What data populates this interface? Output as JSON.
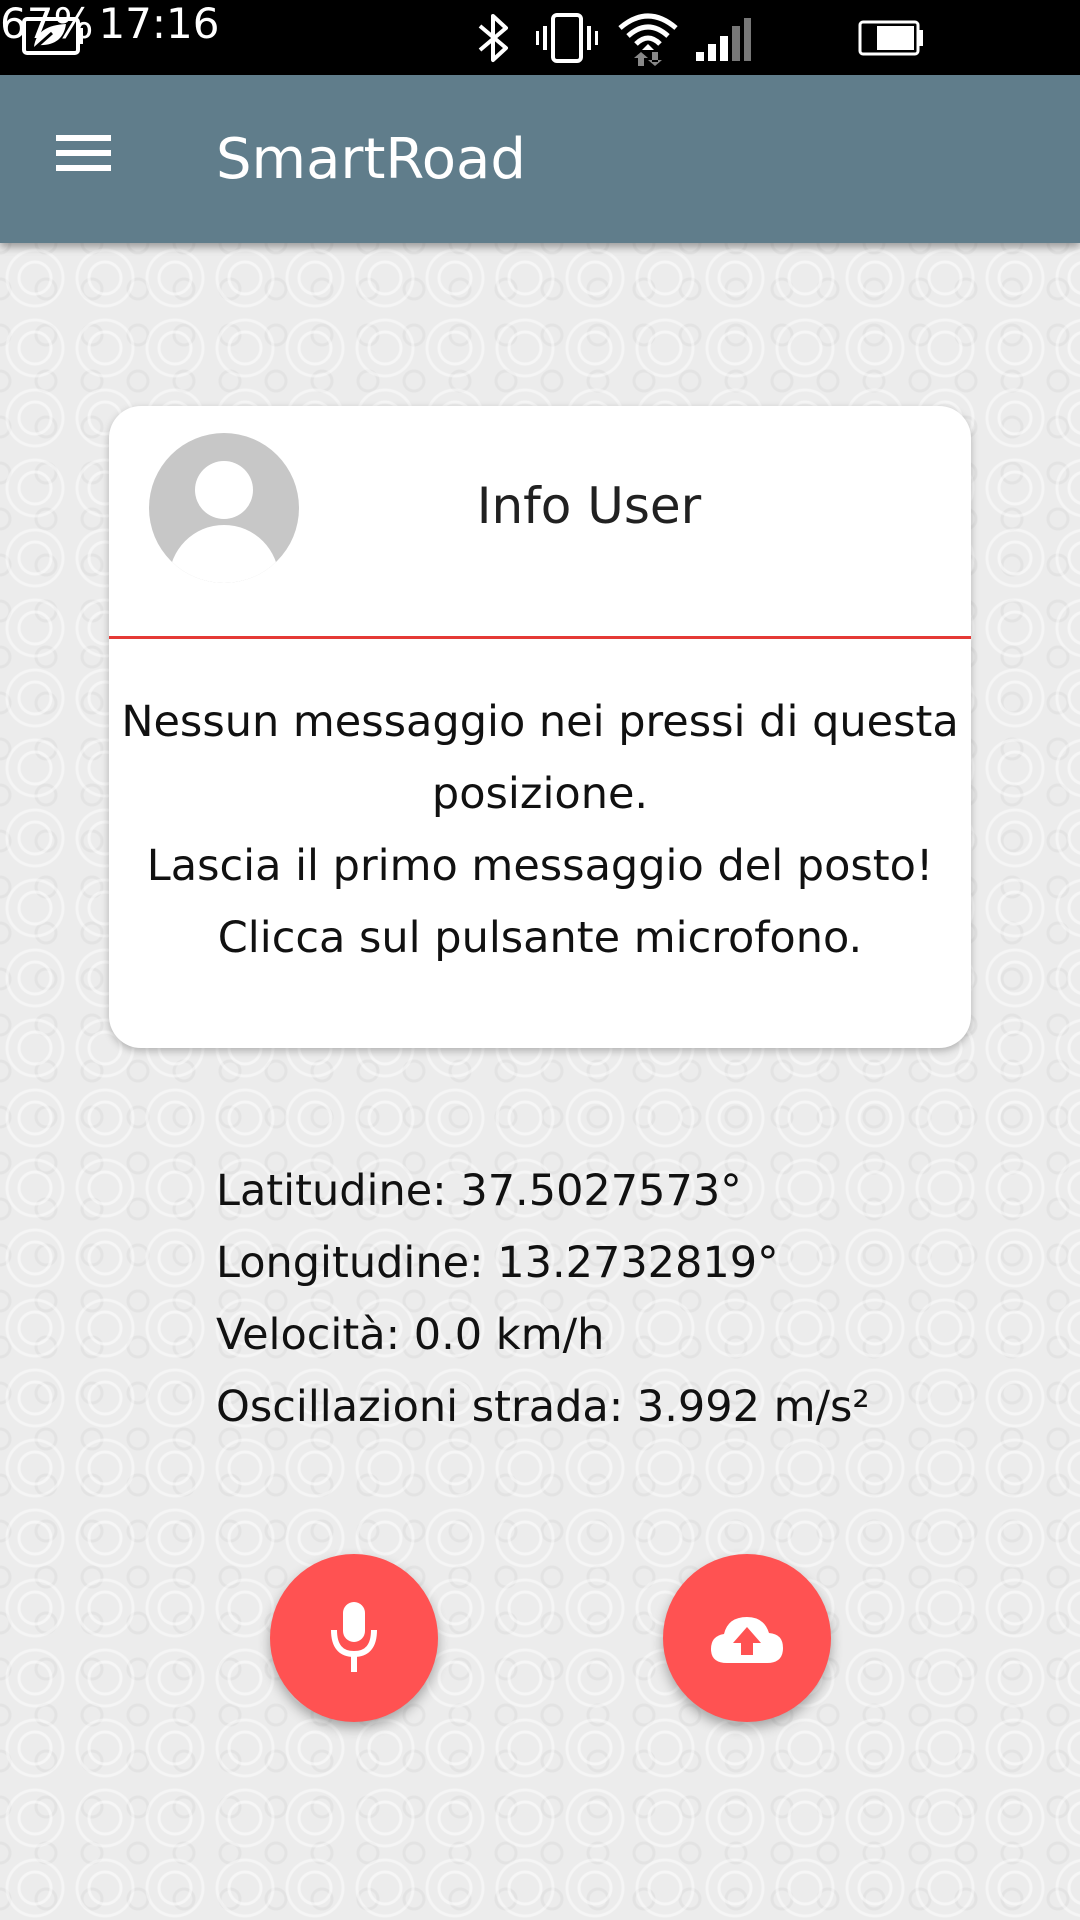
{
  "status_bar": {
    "icons": [
      "leaf-battery-saver-icon",
      "bluetooth-icon",
      "vibrate-icon",
      "wifi-icon",
      "signal-icon",
      "battery-icon"
    ],
    "battery_percent": "67%",
    "time": "17:16"
  },
  "app_bar": {
    "menu_icon": "hamburger-menu-icon",
    "title": "SmartRoad",
    "color": "#607d8b"
  },
  "info_card": {
    "title": "Info User",
    "avatar_icon": "user-avatar-icon",
    "divider_color": "#e53935",
    "message_lines": [
      "Nessun messaggio nei pressi di questa",
      "posizione.",
      "Lascia il primo messaggio del posto!",
      "Clicca sul pulsante microfono."
    ]
  },
  "location": {
    "latitude": "Latitudine: 37.5027573°",
    "longitude": "Longitudine: 13.2732819°",
    "speed": "Velocità: 0.0 km/h",
    "road_oscillations": "Oscillazioni strada: 3.992 m/s²"
  },
  "actions": {
    "accent_color": "#ff5252",
    "mic_icon": "microphone-icon",
    "upload_icon": "cloud-upload-icon"
  }
}
